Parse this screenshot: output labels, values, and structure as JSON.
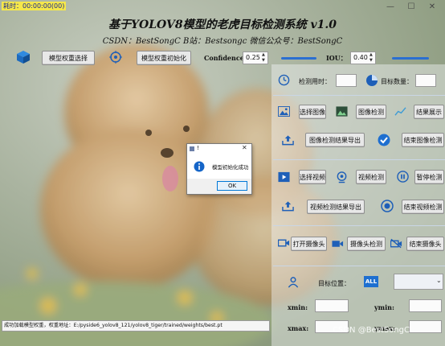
{
  "window": {
    "title": "",
    "timer": "耗时：00:00:00(00)",
    "buttons": {
      "minimize": "—",
      "maximize": "☐",
      "close": "✕"
    }
  },
  "header": {
    "title": "基于YOLOV8模型的老虎目标检测系统 v1.0",
    "subtitle": "CSDN：BestSongC   B站：Bestsongc   微信公众号：BestSongC"
  },
  "toolbar": {
    "select_weights": "模型权重选择",
    "init_weights": "模型权重初始化",
    "confidence_label": "Confidence:",
    "confidence_value": "0.25",
    "iou_label": "IOU：",
    "iou_value": "0.40"
  },
  "stats": {
    "time_label": "检测用时：",
    "count_label": "目标数量："
  },
  "image_section": {
    "select_image": "选择图像",
    "detect_image": "图像检测",
    "show_result": "结果展示",
    "export_result": "图像检测结果导出",
    "end_detect": "结束图像检测"
  },
  "video_section": {
    "select_video": "选择视频",
    "detect_video": "视频检测",
    "pause_detect": "暂停检测",
    "export_result": "视频检测结果导出",
    "end_detect": "结束视频检测"
  },
  "camera_section": {
    "open_camera": "打开摄像头",
    "camera_detect": "摄像头检测",
    "close_camera": "结束摄像头"
  },
  "target": {
    "position_label": "目标位置：",
    "all_icon_label": "ALL",
    "xmin": "xmin:",
    "ymin": "ymin:",
    "xmax": "xmax:",
    "ymax": "ymax:"
  },
  "status": {
    "text": "成功加载模型权重，权重地址：E:/pyside6_yolov8_121/yolov8_tiger/trained/weights/best.pt"
  },
  "dialog": {
    "title": "!",
    "message": "模型初始化成功",
    "ok": "OK"
  },
  "watermark": "CSDN @BestSongC",
  "colors": {
    "accent": "#2b6fd1",
    "title_color": "#111111"
  }
}
